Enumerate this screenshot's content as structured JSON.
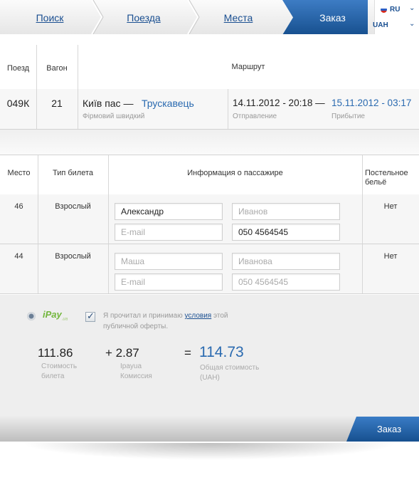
{
  "steps": {
    "search": "Поиск",
    "trains": "Поезда",
    "seats": "Места",
    "order": "Заказ"
  },
  "lang": {
    "language": "RU",
    "currency": "UAH"
  },
  "route_table": {
    "headers": {
      "train": "Поезд",
      "wagon": "Вагон",
      "route": "Маршрут"
    },
    "row": {
      "train": "049К",
      "wagon": "21",
      "from": "Київ пас —",
      "to": "Трускавець",
      "train_type": "Фірмовий швидкий",
      "depart": "14.11.2012 - 20:18 —",
      "arrive": "15.11.2012 - 03:17",
      "depart_label": "Отправление",
      "arrive_label": "Прибытие"
    }
  },
  "passenger_table": {
    "headers": {
      "seat": "Место",
      "ticket_type": "Тип билета",
      "passenger_info": "Информация о пассажире",
      "bedding": "Постельное бельё"
    },
    "rows": [
      {
        "seat": "46",
        "ticket_type": "Взрослый",
        "first_name": {
          "value": "Александр",
          "placeholder": ""
        },
        "last_name": {
          "value": "",
          "placeholder": "Иванов"
        },
        "email": {
          "value": "",
          "placeholder": "E-mail"
        },
        "phone": {
          "value": "050 4564545",
          "placeholder": ""
        },
        "bedding": "Нет"
      },
      {
        "seat": "44",
        "ticket_type": "Взрослый",
        "first_name": {
          "value": "",
          "placeholder": "Маша"
        },
        "last_name": {
          "value": "",
          "placeholder": "Иванова"
        },
        "email": {
          "value": "",
          "placeholder": "E-mail"
        },
        "phone": {
          "value": "",
          "placeholder": "050 4564545"
        },
        "bedding": "Нет"
      }
    ]
  },
  "payment": {
    "method": "iPay",
    "method_suffix": ".ua",
    "offer_text_before": "Я прочитал и принимаю ",
    "offer_link": "условия",
    "offer_text_after": " этой публичной оферты.",
    "ticket_cost": "111.86",
    "ticket_cost_label1": "Стоимость",
    "ticket_cost_label2": "билета",
    "commission": "+ 2.87",
    "commission_label1": "Ipayua",
    "commission_label2": "Комиссия",
    "equals": "=",
    "total": "114.73",
    "total_label1": "Общая стоимость",
    "total_label2": "(UAH)"
  },
  "order_button": "Заказ",
  "colors": {
    "accent_blue": "#2a6ab0",
    "button_blue": "#1f5fa8",
    "ipay_green": "#73b63d"
  }
}
